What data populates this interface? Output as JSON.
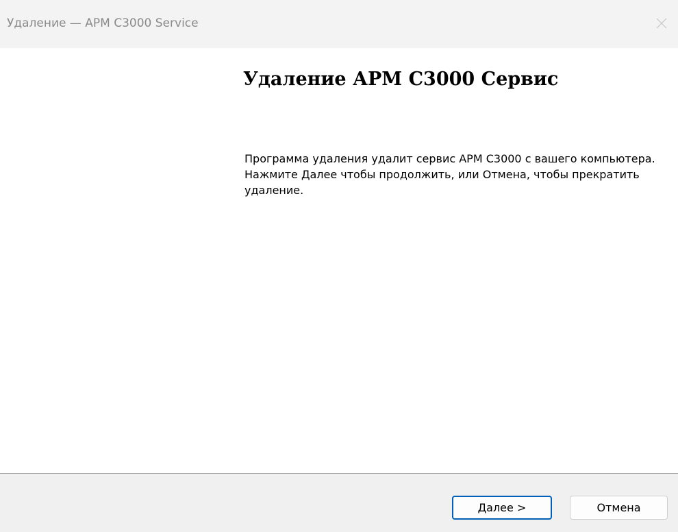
{
  "window": {
    "title": "Удаление — APM C3000 Service",
    "close_icon": "close-icon"
  },
  "main": {
    "heading": "Удаление АРМ С3000 Сервис",
    "description": "Программа удаления удалит сервис АРМ С3000 с вашего компьютера. Нажмите Далее чтобы продолжить, или Отмена, чтобы прекратить удаление."
  },
  "footer": {
    "next_label": "Далее >",
    "cancel_label": "Отмена"
  },
  "colors": {
    "accent": "#005fb8",
    "title_text": "#8a8a8a",
    "footer_bg": "#f0f0f0"
  }
}
